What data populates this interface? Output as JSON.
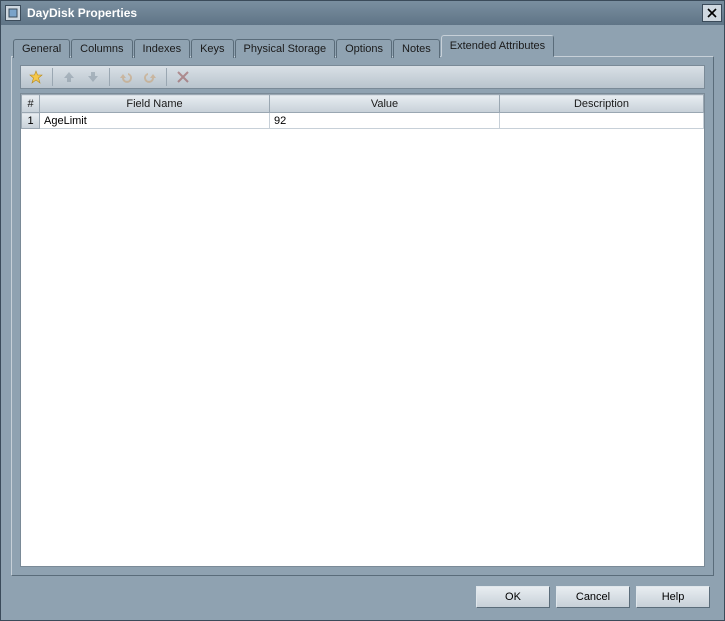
{
  "window": {
    "title": "DayDisk Properties"
  },
  "tabs": [
    {
      "label": "General"
    },
    {
      "label": "Columns"
    },
    {
      "label": "Indexes"
    },
    {
      "label": "Keys"
    },
    {
      "label": "Physical Storage"
    },
    {
      "label": "Options"
    },
    {
      "label": "Notes"
    },
    {
      "label": "Extended Attributes",
      "active": true
    }
  ],
  "toolbar": {
    "new_tip": "New",
    "up_tip": "Move Up",
    "down_tip": "Move Down",
    "undo_tip": "Undo",
    "redo_tip": "Redo",
    "delete_tip": "Delete"
  },
  "grid": {
    "headers": {
      "rownum": "#",
      "field_name": "Field Name",
      "value": "Value",
      "description": "Description"
    },
    "rows": [
      {
        "n": "1",
        "field_name": "AgeLimit",
        "value": "92",
        "description": ""
      }
    ]
  },
  "buttons": {
    "ok": "OK",
    "cancel": "Cancel",
    "help": "Help"
  }
}
